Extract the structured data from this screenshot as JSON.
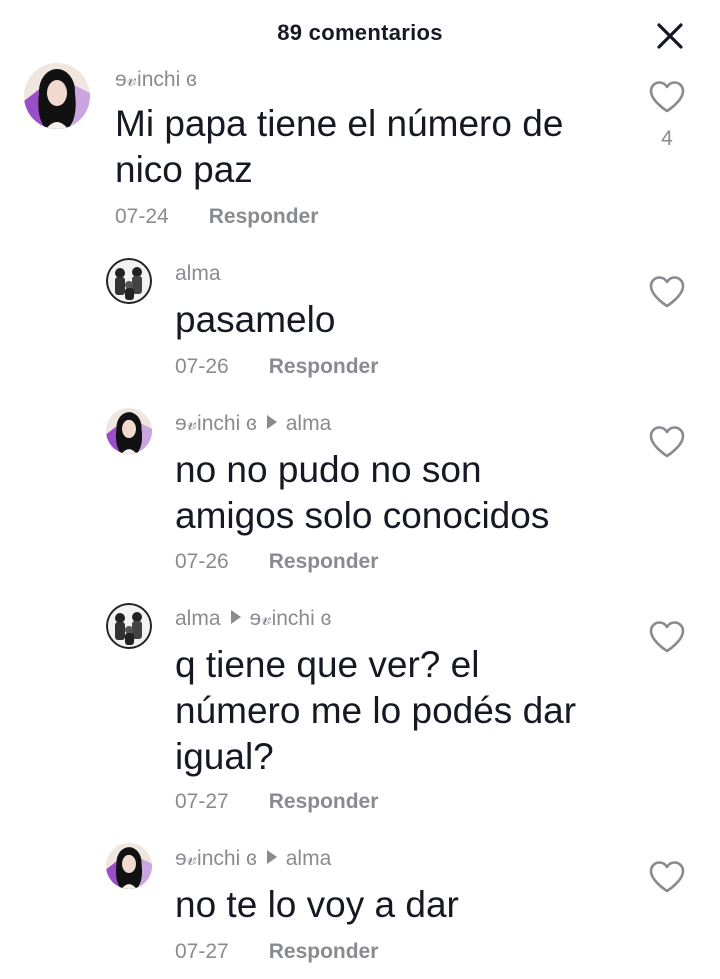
{
  "header": {
    "title": "89 comentarios"
  },
  "comments": [
    {
      "user": "ɘ𝓋inchi ɞ",
      "reply_to": "",
      "text_lines": [
        "Mi papa tiene el número de",
        "nico paz"
      ],
      "date": "07-24",
      "reply_label": "Responder",
      "likes": "4",
      "avatar": "girl-avatar-icon"
    },
    {
      "user": "alma",
      "reply_to": "",
      "text_lines": [
        "pasamelo"
      ],
      "date": "07-26",
      "reply_label": "Responder",
      "likes": "",
      "avatar": "group-photo-avatar-icon"
    },
    {
      "user": "ɘ𝓋inchi ɞ",
      "reply_to": "alma",
      "text_lines": [
        "no no pudo no son",
        "amigos solo conocidos"
      ],
      "date": "07-26",
      "reply_label": "Responder",
      "likes": "",
      "avatar": "girl-avatar-icon"
    },
    {
      "user": "alma",
      "reply_to": "ɘ𝓋inchi ɞ",
      "text_lines": [
        "q tiene que ver? el",
        "número me lo podés dar",
        "igual?"
      ],
      "date": "07-27",
      "reply_label": "Responder",
      "likes": "",
      "avatar": "group-photo-avatar-icon"
    },
    {
      "user": "ɘ𝓋inchi ɞ",
      "reply_to": "alma",
      "text_lines": [
        "no te lo voy a dar"
      ],
      "date": "07-27",
      "reply_label": "Responder",
      "likes": "",
      "avatar": "girl-avatar-icon"
    }
  ],
  "icons": {
    "close": "close-icon",
    "like": "heart-outline-icon"
  },
  "colors": {
    "text": "#161823",
    "muted": "#8a8b91",
    "background": "#ffffff"
  }
}
